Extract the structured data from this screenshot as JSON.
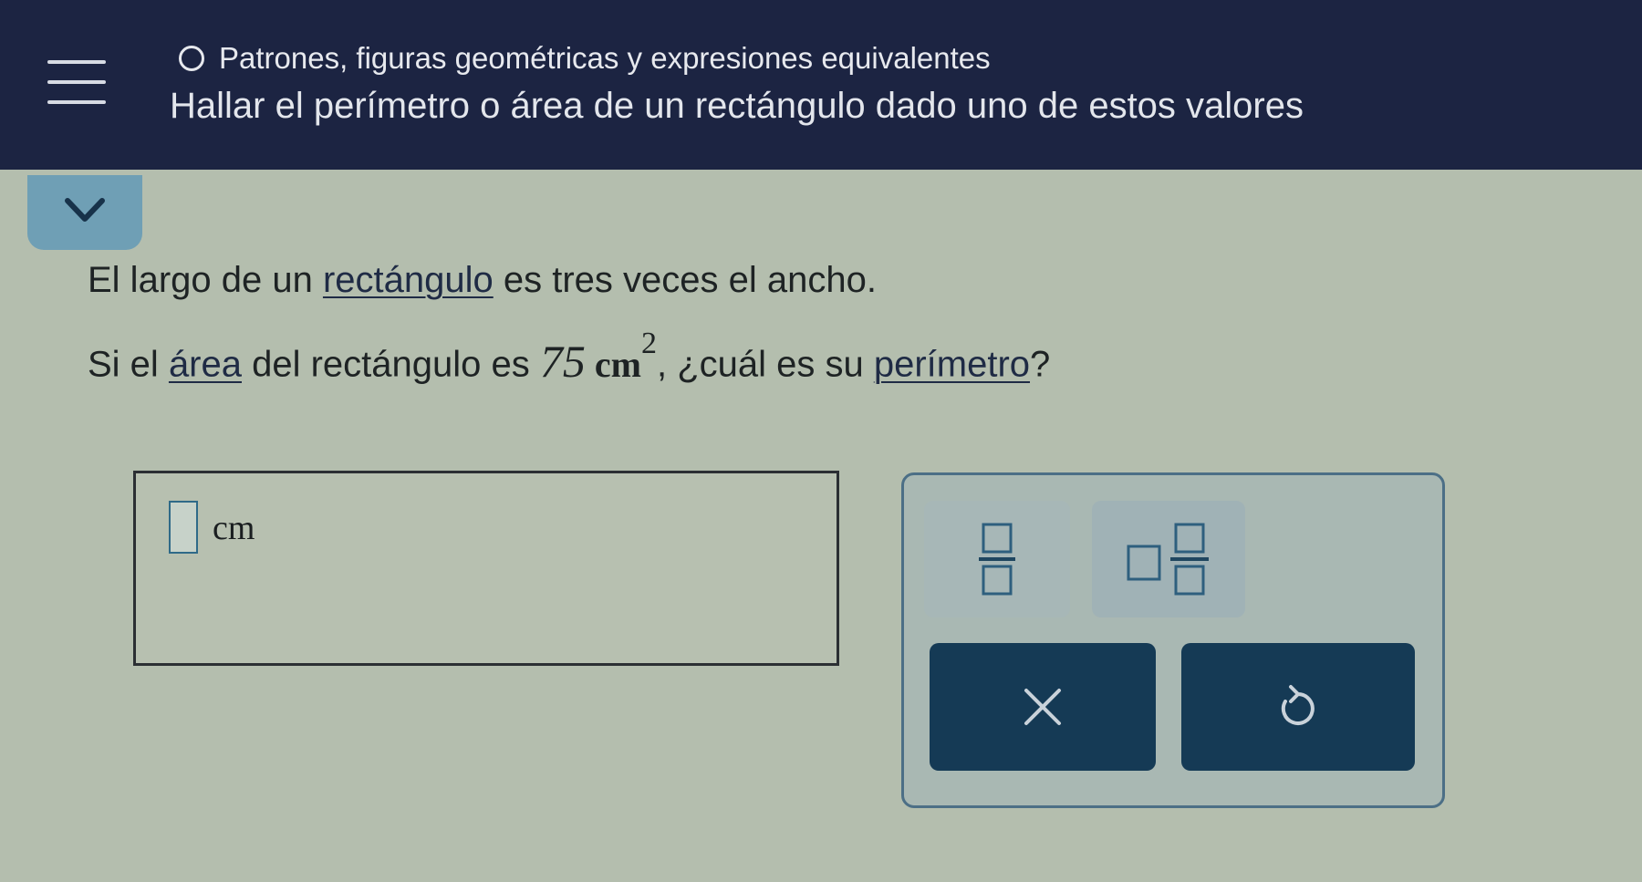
{
  "header": {
    "topic": "Patrones, figuras geométricas y expresiones equivalentes",
    "lesson_title": "Hallar el perímetro o área de un rectángulo dado uno de estos valores"
  },
  "question": {
    "line1_before": "El largo de un ",
    "line1_term": "rectángulo",
    "line1_after": " es tres veces el ancho.",
    "line2_before": "Si el ",
    "line2_term_area": "área",
    "line2_middle": " del rectángulo es ",
    "area_value": "75",
    "area_unit": "cm",
    "area_exponent": "2",
    "line2_after_math": ", ¿cuál es su ",
    "line2_term_perimeter": "perímetro",
    "line2_end": "?"
  },
  "answer": {
    "value": "",
    "unit": "cm"
  },
  "keypad": {
    "tools": [
      "fraction-icon",
      "mixed-number-icon"
    ],
    "buttons": [
      "clear-icon",
      "undo-icon"
    ]
  },
  "colors": {
    "header_bg": "#1c2442",
    "background": "#b4beae",
    "button_bg": "#153a55",
    "accent": "#6f9fb5"
  }
}
